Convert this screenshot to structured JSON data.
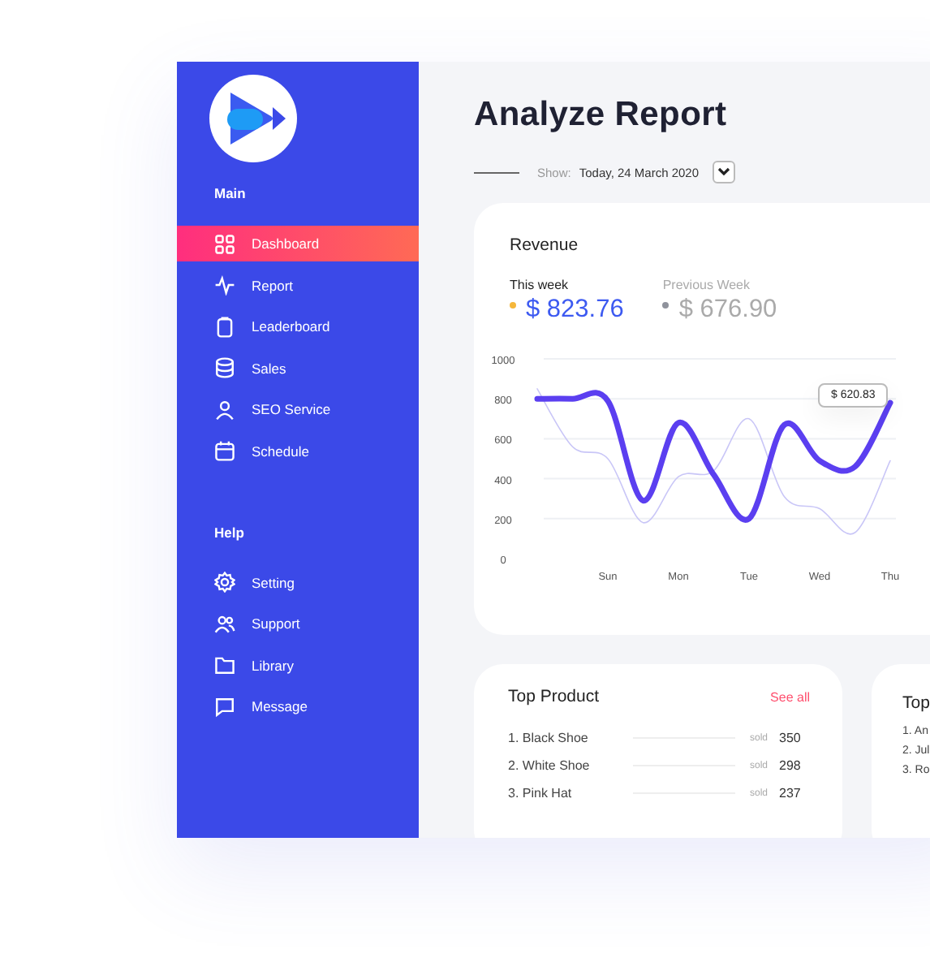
{
  "sidebar": {
    "sections": [
      {
        "heading": "Main",
        "items": [
          {
            "label": "Dashboard",
            "selected": true
          },
          {
            "label": "Report",
            "selected": false
          },
          {
            "label": "Leaderboard",
            "selected": false
          },
          {
            "label": "Sales",
            "selected": false
          },
          {
            "label": "SEO Service",
            "selected": false
          },
          {
            "label": "Schedule",
            "selected": false
          }
        ]
      },
      {
        "heading": "Help",
        "items": [
          {
            "label": "Setting",
            "selected": false
          },
          {
            "label": "Support",
            "selected": false
          },
          {
            "label": "Library",
            "selected": false
          },
          {
            "label": "Message",
            "selected": false
          }
        ]
      }
    ]
  },
  "page": {
    "title": "Analyze Report",
    "show_label": "Show:",
    "show_value": "Today, 24 March 2020"
  },
  "revenue": {
    "title": "Revenue",
    "stats": [
      {
        "label": "This week",
        "value": "$ 823.76",
        "color": "#f5b73b"
      },
      {
        "label": "Previous Week",
        "value": "$ 676.90",
        "color": "#8f929c"
      }
    ],
    "tooltip": "$ 620.83",
    "chart_data": {
      "type": "line",
      "categories": [
        null,
        null,
        "Sun",
        null,
        "Mon",
        null,
        "Tue",
        null,
        "Wed",
        null,
        "Thu"
      ],
      "series": [
        {
          "color": "#5b3ff0",
          "values": [
            800,
            800,
            790,
            290,
            680,
            420,
            200,
            670,
            490,
            460,
            780
          ]
        },
        {
          "color": "#c9c6f7",
          "values": [
            850,
            560,
            500,
            180,
            410,
            440,
            700,
            310,
            250,
            130,
            490
          ]
        }
      ],
      "ylim": [
        0,
        1000
      ],
      "grid": true,
      "yticks": [
        0,
        200,
        400,
        600,
        800,
        1000
      ]
    }
  },
  "top_product": {
    "title": "Top Product",
    "link": "See all",
    "rows": [
      {
        "name": "1. Black Shoe",
        "sold_label": "sold",
        "count": "350"
      },
      {
        "name": "2. White Shoe",
        "sold_label": "sold",
        "count": "298"
      },
      {
        "name": "3. Pink Hat",
        "sold_label": "sold",
        "count": "237"
      }
    ]
  },
  "second_card": {
    "title": "Top",
    "rows": [
      "1. An",
      "2. Jul",
      "3. Ro"
    ]
  }
}
